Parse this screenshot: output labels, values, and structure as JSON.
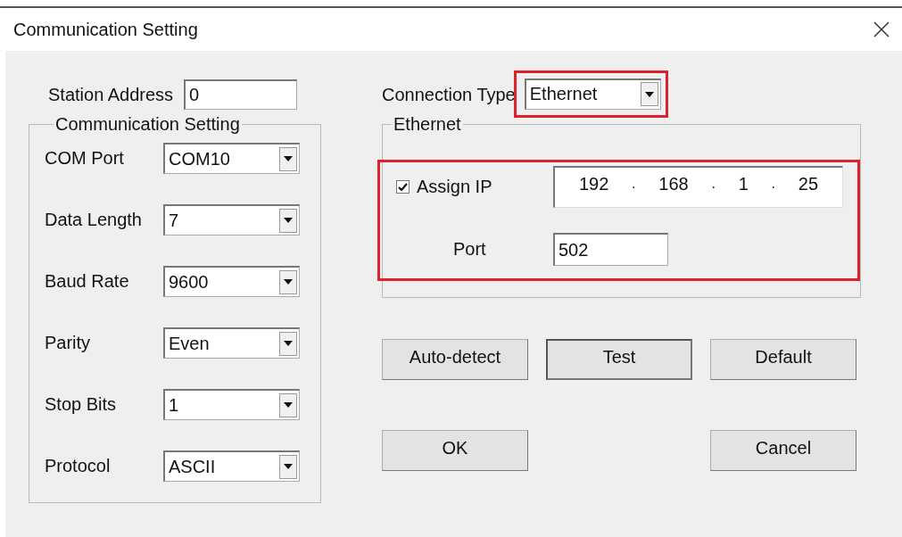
{
  "window": {
    "title": "Communication Setting"
  },
  "station_address": {
    "label": "Station Address",
    "value": "0"
  },
  "communication_setting": {
    "title": "Communication Setting",
    "fields": [
      {
        "label": "COM Port",
        "value": "COM10"
      },
      {
        "label": "Data Length",
        "value": "7"
      },
      {
        "label": "Baud Rate",
        "value": "9600"
      },
      {
        "label": "Parity",
        "value": "Even"
      },
      {
        "label": "Stop Bits",
        "value": "1"
      },
      {
        "label": "Protocol",
        "value": "ASCII"
      }
    ]
  },
  "connection_type": {
    "label": "Connection Type",
    "value": "Ethernet",
    "highlighted": true
  },
  "ethernet": {
    "title": "Ethernet",
    "highlighted": true,
    "assign_ip": {
      "label": "Assign IP",
      "checked": true
    },
    "ip_address": [
      {
        "kind": "octet",
        "text": "192"
      },
      {
        "kind": "dot",
        "text": "."
      },
      {
        "kind": "octet",
        "text": "168"
      },
      {
        "kind": "dot",
        "text": "."
      },
      {
        "kind": "octet",
        "text": "1"
      },
      {
        "kind": "dot",
        "text": "."
      },
      {
        "kind": "octet",
        "text": "25"
      }
    ],
    "port": {
      "label": "Port",
      "value": "502"
    }
  },
  "buttons": [
    {
      "label": "Auto-detect",
      "default": false
    },
    {
      "label": "Test",
      "default": true
    },
    {
      "label": "Default",
      "default": false
    }
  ],
  "dialog_buttons": [
    {
      "label": "OK",
      "default": false
    },
    {
      "label": "Cancel",
      "default": false
    }
  ]
}
